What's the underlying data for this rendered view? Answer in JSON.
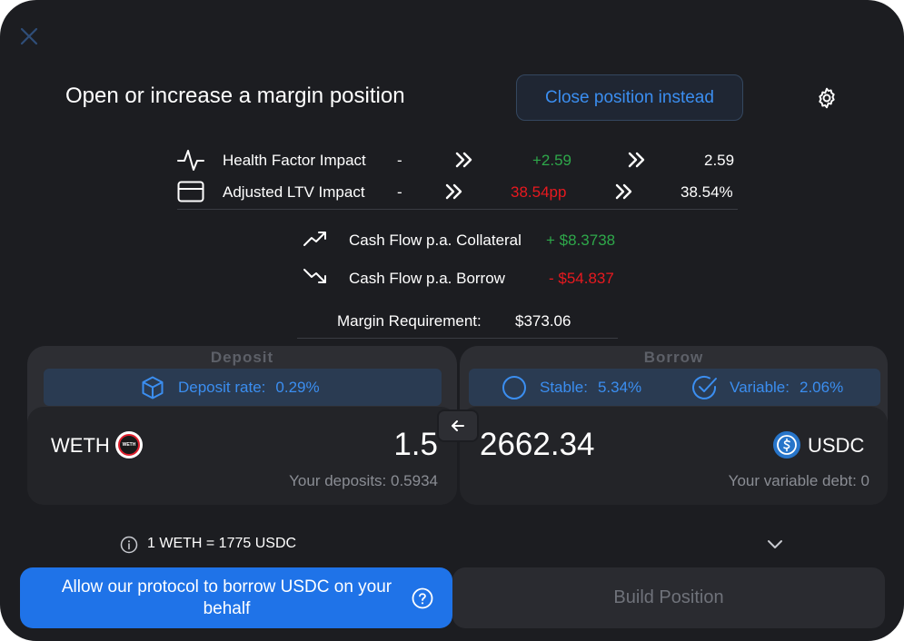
{
  "header": {
    "title": "Open or increase a margin position",
    "close_position_label": "Close position instead"
  },
  "impact": {
    "health": {
      "label": "Health Factor Impact",
      "current": "-",
      "change": "+2.59",
      "result": "2.59"
    },
    "ltv": {
      "label": "Adjusted LTV Impact",
      "current": "-",
      "change": "38.54pp",
      "result": "38.54%"
    }
  },
  "cashflow": {
    "collateral": {
      "label": "Cash Flow p.a. Collateral",
      "value": "+ $8.3738"
    },
    "borrow": {
      "label": "Cash Flow p.a. Borrow",
      "value": "- $54.837"
    }
  },
  "margin": {
    "label": "Margin Requirement:",
    "value": "$373.06"
  },
  "deposit": {
    "title": "Deposit",
    "rate_label": "Deposit rate:",
    "rate_value": "0.29%",
    "token": "WETH",
    "token_logo_text": "WETH",
    "amount": "1.5",
    "your_deposits": "Your deposits: 0.5934"
  },
  "borrow": {
    "title": "Borrow",
    "stable_label": "Stable:",
    "stable_value": "5.34%",
    "variable_label": "Variable:",
    "variable_value": "2.06%",
    "token": "USDC",
    "amount": "2662.34",
    "your_debt": "Your variable debt: 0"
  },
  "exchange": {
    "rate": "1 WETH = 1775 USDC"
  },
  "actions": {
    "allow_label": "Allow our protocol to borrow USDC on your behalf",
    "build_label": "Build Position"
  },
  "colors": {
    "background": "#1c1d21",
    "accent": "#1f73e8",
    "positive": "#2ea84a",
    "negative": "#e8191f",
    "link": "#3b8ef0"
  },
  "icons": {
    "close": "close-icon",
    "settings": "gear-icon",
    "health": "pulse-icon",
    "ltv": "card-icon",
    "collateral": "trend-up-icon",
    "borrow": "trend-down-icon",
    "deposit_rate": "cube-icon",
    "stable": "circle-icon",
    "variable": "check-circle-icon",
    "swap": "arrow-left-icon",
    "info": "info-icon",
    "expand": "chevron-down-icon",
    "help": "question-circle-icon"
  }
}
